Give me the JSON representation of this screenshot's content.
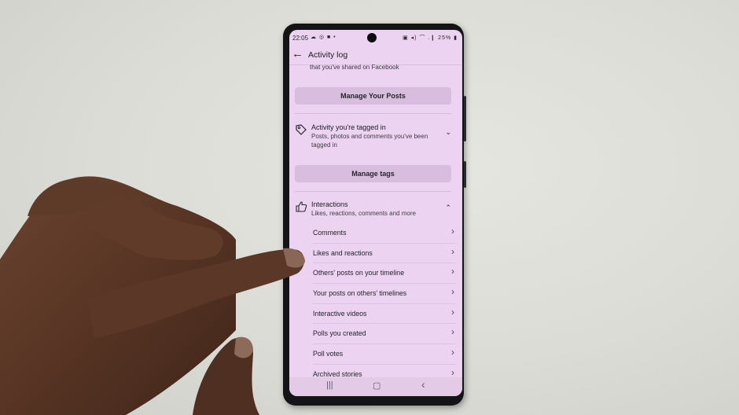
{
  "status_bar": {
    "time": "22:05",
    "left_icons": "☁ ◎ ■ •",
    "right_icons": "▣ ◂) ⌒ .❙",
    "battery": "25%"
  },
  "app_bar": {
    "back_icon": "←",
    "title": "Activity log"
  },
  "truncated_text": "that you've shared on Facebook",
  "manage_posts_button": "Manage Your Posts",
  "tagged_section": {
    "title": "Activity you're tagged in",
    "subtitle": "Posts, photos and comments you've been tagged in",
    "chevron": "⌄",
    "icon": "tag-icon"
  },
  "manage_tags_button": "Manage tags",
  "interactions_section": {
    "title": "Interactions",
    "subtitle": "Likes, reactions, comments and more",
    "chevron": "⌃",
    "icon": "thumbs-up-icon"
  },
  "interactions_items": [
    {
      "label": "Comments"
    },
    {
      "label": "Likes and reactions"
    },
    {
      "label": "Others' posts on your timeline"
    },
    {
      "label": "Your posts on others' timelines"
    },
    {
      "label": "Interactive videos"
    },
    {
      "label": "Polls you created"
    },
    {
      "label": "Poll votes"
    },
    {
      "label": "Archived stories"
    }
  ],
  "nav_bar": {
    "recents": "|||",
    "home": "▢",
    "back": "‹"
  },
  "item_arrow": "›"
}
